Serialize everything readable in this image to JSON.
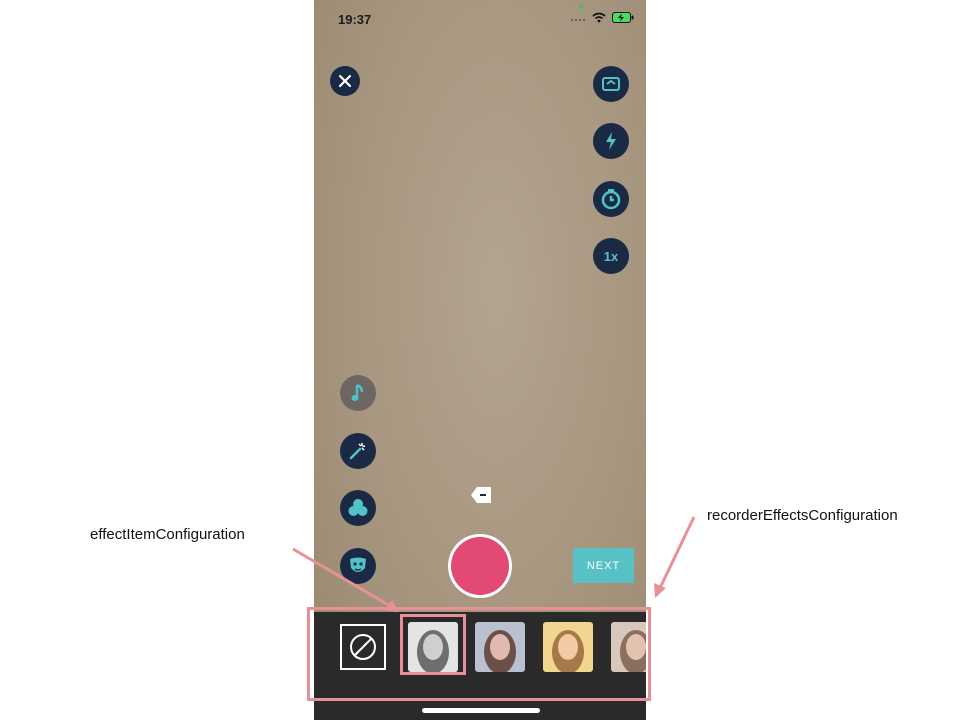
{
  "status": {
    "time": "19:37"
  },
  "controls": {
    "zoom_label": "1x",
    "next_label": "NEXT"
  },
  "annotations": {
    "effect_item": "effectItemConfiguration",
    "recorder_effects": "recorderEffectsConfiguration"
  },
  "effects": {
    "items": [
      {
        "name": "none",
        "icon": "no-effect-icon"
      },
      {
        "name": "effect-1",
        "tint": "#d8d8d8"
      },
      {
        "name": "effect-2",
        "tint": "#aeb3c4"
      },
      {
        "name": "effect-3",
        "tint": "#e8cf8f"
      },
      {
        "name": "effect-4",
        "tint": "#c9b7a7"
      }
    ]
  },
  "colors": {
    "button_bg": "#1b2a44",
    "icon_accent": "#4fc3c8",
    "record": "#e34a73",
    "next_bg": "#58c1c6",
    "annotation": "#e89097"
  }
}
